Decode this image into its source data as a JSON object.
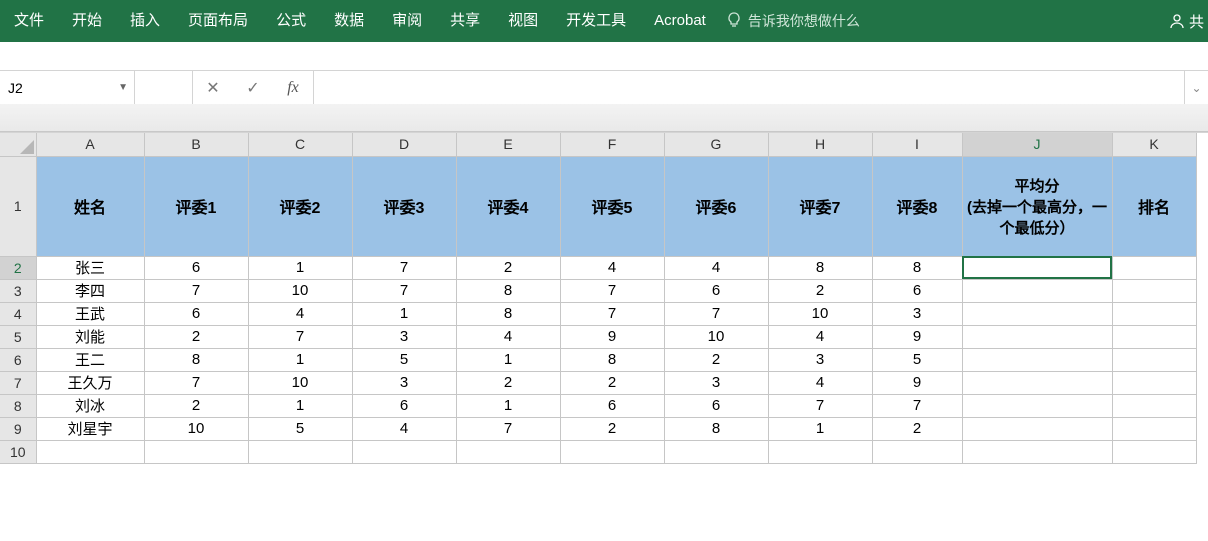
{
  "ribbon": {
    "tabs": [
      "文件",
      "开始",
      "插入",
      "页面布局",
      "公式",
      "数据",
      "审阅",
      "共享",
      "视图",
      "开发工具",
      "Acrobat"
    ],
    "tell_me": "告诉我你想做什么",
    "share": "共"
  },
  "formula_bar": {
    "name_box": "J2",
    "cancel_glyph": "✕",
    "enter_glyph": "✓",
    "fx_label": "fx",
    "formula_value": "",
    "expand_glyph": "⌄"
  },
  "sheet": {
    "columns": [
      "A",
      "B",
      "C",
      "D",
      "E",
      "F",
      "G",
      "H",
      "I",
      "J",
      "K"
    ],
    "row_numbers": [
      1,
      2,
      3,
      4,
      5,
      6,
      7,
      8,
      9,
      10
    ],
    "headers": [
      "姓名",
      "评委1",
      "评委2",
      "评委3",
      "评委4",
      "评委5",
      "评委6",
      "评委7",
      "评委8",
      "平均分\n(去掉一个最高分，一个最低分）",
      "排名"
    ],
    "rows": [
      {
        "name": "张三",
        "scores": [
          6,
          1,
          7,
          2,
          4,
          4,
          8,
          8
        ],
        "avg": "",
        "rank": ""
      },
      {
        "name": "李四",
        "scores": [
          7,
          10,
          7,
          8,
          7,
          6,
          2,
          6
        ],
        "avg": "",
        "rank": ""
      },
      {
        "name": "王武",
        "scores": [
          6,
          4,
          1,
          8,
          7,
          7,
          10,
          3
        ],
        "avg": "",
        "rank": ""
      },
      {
        "name": "刘能",
        "scores": [
          2,
          7,
          3,
          4,
          9,
          10,
          4,
          9
        ],
        "avg": "",
        "rank": ""
      },
      {
        "name": "王二",
        "scores": [
          8,
          1,
          5,
          1,
          8,
          2,
          3,
          5
        ],
        "avg": "",
        "rank": ""
      },
      {
        "name": "王久万",
        "scores": [
          7,
          10,
          3,
          2,
          2,
          3,
          4,
          9
        ],
        "avg": "",
        "rank": ""
      },
      {
        "name": "刘冰",
        "scores": [
          2,
          1,
          6,
          1,
          6,
          6,
          7,
          7
        ],
        "avg": "",
        "rank": ""
      },
      {
        "name": "刘星宇",
        "scores": [
          10,
          5,
          4,
          7,
          2,
          8,
          1,
          2
        ],
        "avg": "",
        "rank": ""
      }
    ],
    "selected_cell": "J2"
  }
}
